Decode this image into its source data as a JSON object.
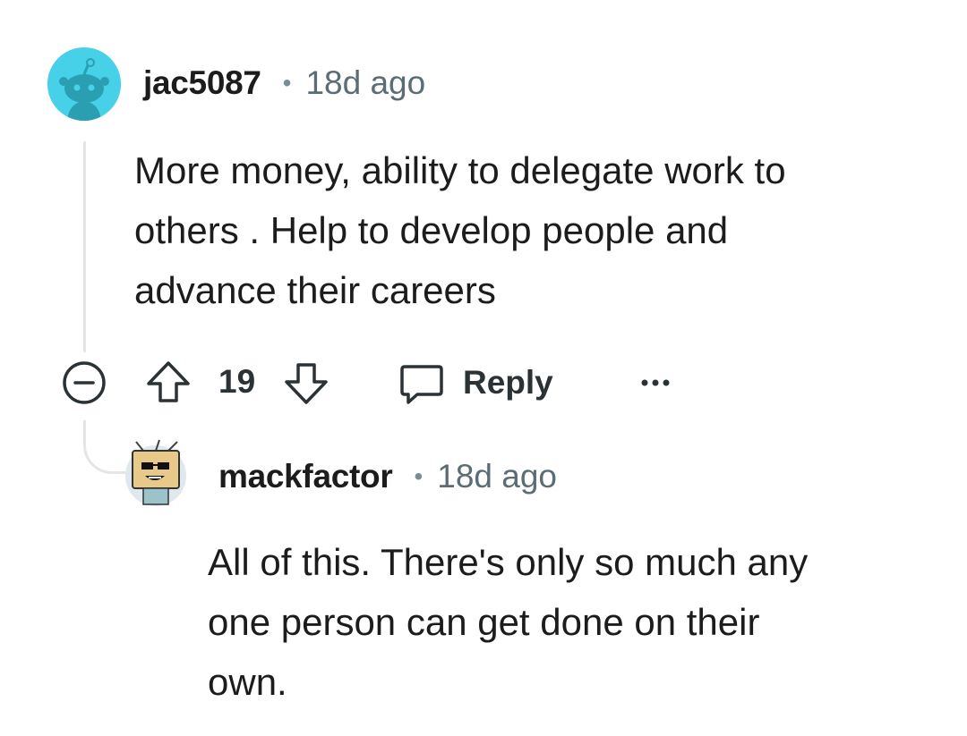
{
  "comments": [
    {
      "username": "jac5087",
      "time": "18d ago",
      "lines": [
        "More money, ability to delegate work to",
        "others . Help to develop people and",
        "advance their careers"
      ],
      "votes": "19",
      "reply_label": "Reply",
      "avatar_icon": "snoo-avatar-icon"
    },
    {
      "username": "mackfactor",
      "time": "18d ago",
      "lines": [
        "All of this. There's only so much any",
        "one person can get done on their",
        "own."
      ],
      "avatar_icon": "tv-robot-avatar-icon"
    }
  ],
  "colors": {
    "avatar1_bg": "#46d1e8",
    "meta_text": "#5c6c74",
    "thread_line": "#e5e5e5"
  }
}
